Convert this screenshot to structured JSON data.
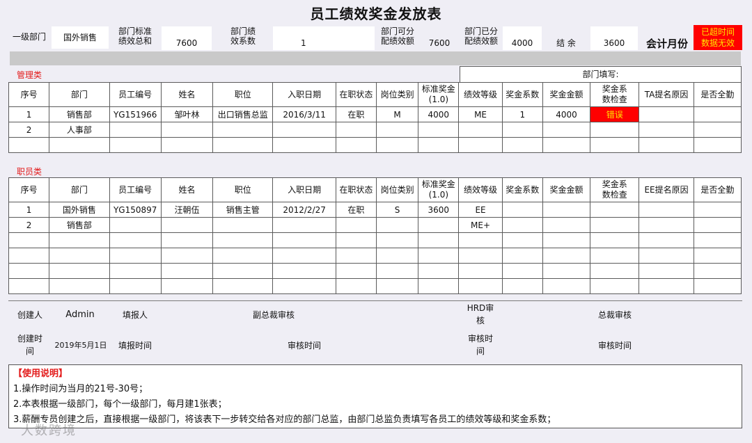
{
  "title": "员工绩效奖金发放表",
  "header": {
    "dept1_label": "一级部门",
    "dept1_value": "国外销售",
    "std_total_label": "部门标准\n绩效总和",
    "std_total_value": "7600",
    "coef_label": "部门绩\n效系数",
    "coef_value": "1",
    "alloc_label": "部门可分\n配绩效额",
    "alloc_value": "7600",
    "allocated_label": "部门已分\n配绩效额",
    "allocated_value": "4000",
    "balance_label": "结  余",
    "balance_value": "3600",
    "month_label": "会计月份",
    "warning_text": "已超时间\n数据无效",
    "warning_color": "#ff0000"
  },
  "mgmt": {
    "label": "管理类",
    "dept_fill_label": "部门填写:",
    "columns": [
      "序号",
      "部门",
      "员工编号",
      "姓名",
      "职位",
      "入职日期",
      "在职状态",
      "岗位类别",
      "标准奖金\n(1.0)",
      "绩效等级",
      "奖金系数",
      "奖金金额",
      "奖金系\n数检查",
      "TA提名原因",
      "是否全勤"
    ],
    "rows": [
      [
        "1",
        "销售部",
        "YG151966",
        "邹叶林",
        "出口销售总监",
        "2016/3/11",
        "在职",
        "M",
        "4000",
        "ME",
        "1",
        "4000",
        "错误",
        "",
        ""
      ],
      [
        "2",
        "人事部",
        "",
        "",
        "",
        "",
        "",
        "",
        "",
        "",
        "",
        "",
        "",
        "",
        ""
      ],
      [
        "",
        "",
        "",
        "",
        "",
        "",
        "",
        "",
        "",
        "",
        "",
        "",
        "",
        "",
        ""
      ]
    ]
  },
  "staff": {
    "label": "职员类",
    "columns": [
      "序号",
      "部门",
      "员工编号",
      "姓名",
      "职位",
      "入职日期",
      "在职状态",
      "岗位类别",
      "标准奖金\n(1.0)",
      "绩效等级",
      "奖金系数",
      "奖金金额",
      "奖金系\n数检查",
      "EE提名原因",
      "是否全勤"
    ],
    "rows": [
      [
        "1",
        "国外销售",
        "YG150897",
        "汪朝伍",
        "销售主管",
        "2012/2/27",
        "在职",
        "S",
        "3600",
        "EE",
        "",
        "",
        "",
        "",
        ""
      ],
      [
        "2",
        "销售部",
        "",
        "",
        "",
        "",
        "",
        "",
        "",
        "ME+",
        "",
        "",
        "",
        "",
        ""
      ],
      [
        "",
        "",
        "",
        "",
        "",
        "",
        "",
        "",
        "",
        "",
        "",
        "",
        "",
        "",
        ""
      ],
      [
        "",
        "",
        "",
        "",
        "",
        "",
        "",
        "",
        "",
        "",
        "",
        "",
        "",
        "",
        ""
      ],
      [
        "",
        "",
        "",
        "",
        "",
        "",
        "",
        "",
        "",
        "",
        "",
        "",
        "",
        "",
        ""
      ],
      [
        "",
        "",
        "",
        "",
        "",
        "",
        "",
        "",
        "",
        "",
        "",
        "",
        "",
        "",
        ""
      ]
    ]
  },
  "footer": {
    "creator_label": "创建人",
    "creator_value": "Admin",
    "filler_label": "填报人",
    "vp_label": "副总裁审核",
    "hrd_label": "HRD审\n核",
    "ceo_label": "总裁审核",
    "created_time_label": "创建时\n间",
    "created_time_value": "2019年5月1日",
    "fill_time_label": "填报时间",
    "review_time_label_1": "审核时间",
    "review_time_label_2": "审核时\n间",
    "review_time_label_3": "审核时间"
  },
  "notes": {
    "title": "【使用说明】",
    "lines": [
      "1.操作时间为当月的21号-30号；",
      "2.本表根据一级部门，每个一级部门，每月建1张表；",
      "3.薪酬专员创建之后，直接根据一级部门，将该表下一步转交给各对应的部门总监，由部门总监负责填写各员工的绩效等级和奖金系数；"
    ]
  },
  "watermark": "大数跨境"
}
